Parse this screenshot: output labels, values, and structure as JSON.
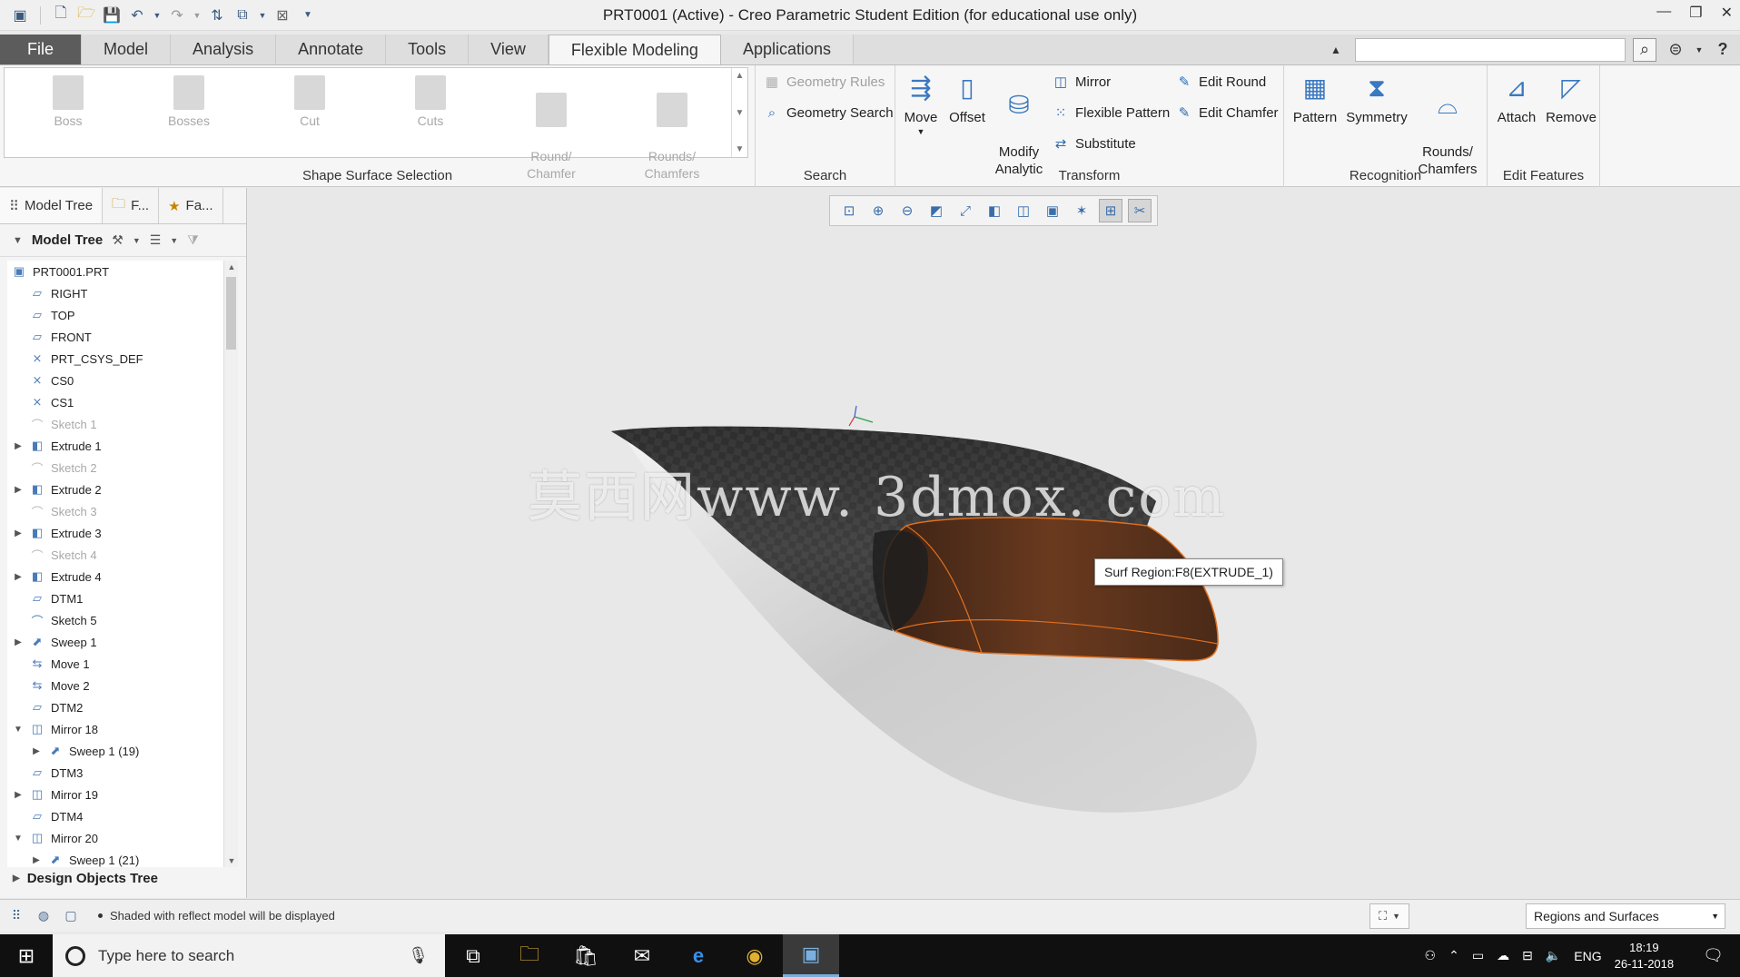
{
  "window": {
    "title": "PRT0001 (Active) - Creo Parametric Student Edition (for educational use only)",
    "controls": [
      "—",
      "❐",
      "✕"
    ]
  },
  "quick_access": [
    "new-icon",
    "open-icon",
    "save-icon",
    "undo-icon",
    "redo-icon",
    "regenerate-icon",
    "windows-icon",
    "close-window-icon"
  ],
  "ribbon_tabs": [
    {
      "label": "File"
    },
    {
      "label": "Model"
    },
    {
      "label": "Analysis"
    },
    {
      "label": "Annotate"
    },
    {
      "label": "Tools"
    },
    {
      "label": "View"
    },
    {
      "label": "Flexible Modeling"
    },
    {
      "label": "Applications"
    }
  ],
  "ribbon": {
    "shape_surface": {
      "label": "Shape Surface Selection",
      "items": [
        "Boss",
        "Bosses",
        "Cut",
        "Cuts",
        "Round/\nChamfer",
        "Rounds/\nChamfers"
      ]
    },
    "search": {
      "label": "Search",
      "geometry_rules": "Geometry Rules",
      "geometry_search": "Geometry Search"
    },
    "transform": {
      "label": "Transform",
      "move": "Move",
      "offset": "Offset",
      "modify_analytic": "Modify\nAnalytic",
      "mirror": "Mirror",
      "flexible_pattern": "Flexible Pattern",
      "substitute": "Substitute",
      "edit_round": "Edit Round",
      "edit_chamfer": "Edit Chamfer"
    },
    "recognition": {
      "label": "Recognition",
      "pattern": "Pattern",
      "symmetry": "Symmetry",
      "rounds_chamfers": "Rounds/\nChamfers"
    },
    "edit_features": {
      "label": "Edit Features",
      "attach": "Attach",
      "remove": "Remove"
    }
  },
  "navigator": {
    "tabs": [
      "Model Tree",
      "F...",
      "Fa..."
    ],
    "header": "Model Tree",
    "design_objects": "Design Objects Tree",
    "tree": [
      {
        "label": "PRT0001.PRT",
        "icon": "part-icon",
        "level": 0,
        "expander": "",
        "dim": false
      },
      {
        "label": "RIGHT",
        "icon": "datum-plane-icon",
        "level": 1,
        "expander": "",
        "dim": false
      },
      {
        "label": "TOP",
        "icon": "datum-plane-icon",
        "level": 1,
        "expander": "",
        "dim": false
      },
      {
        "label": "FRONT",
        "icon": "datum-plane-icon",
        "level": 1,
        "expander": "",
        "dim": false
      },
      {
        "label": "PRT_CSYS_DEF",
        "icon": "csys-icon",
        "level": 1,
        "expander": "",
        "dim": false
      },
      {
        "label": "CS0",
        "icon": "csys-icon",
        "level": 1,
        "expander": "",
        "dim": false
      },
      {
        "label": "CS1",
        "icon": "csys-icon",
        "level": 1,
        "expander": "",
        "dim": false
      },
      {
        "label": "Sketch 1",
        "icon": "sketch-icon",
        "level": 1,
        "expander": "",
        "dim": true
      },
      {
        "label": "Extrude 1",
        "icon": "extrude-icon",
        "level": 1,
        "expander": "▶",
        "dim": false
      },
      {
        "label": "Sketch 2",
        "icon": "sketch-icon",
        "level": 1,
        "expander": "",
        "dim": true
      },
      {
        "label": "Extrude 2",
        "icon": "extrude-icon",
        "level": 1,
        "expander": "▶",
        "dim": false
      },
      {
        "label": "Sketch 3",
        "icon": "sketch-icon",
        "level": 1,
        "expander": "",
        "dim": true
      },
      {
        "label": "Extrude 3",
        "icon": "extrude-icon",
        "level": 1,
        "expander": "▶",
        "dim": false
      },
      {
        "label": "Sketch 4",
        "icon": "sketch-icon",
        "level": 1,
        "expander": "",
        "dim": true
      },
      {
        "label": "Extrude 4",
        "icon": "extrude-icon",
        "level": 1,
        "expander": "▶",
        "dim": false
      },
      {
        "label": "DTM1",
        "icon": "datum-plane-icon",
        "level": 1,
        "expander": "",
        "dim": false
      },
      {
        "label": "Sketch 5",
        "icon": "sketch-icon",
        "level": 1,
        "expander": "",
        "dim": false
      },
      {
        "label": "Sweep 1",
        "icon": "sweep-icon",
        "level": 1,
        "expander": "▶",
        "dim": false
      },
      {
        "label": "Move 1",
        "icon": "move-icon",
        "level": 1,
        "expander": "",
        "dim": false
      },
      {
        "label": "Move 2",
        "icon": "move-icon",
        "level": 1,
        "expander": "",
        "dim": false
      },
      {
        "label": "DTM2",
        "icon": "datum-plane-icon",
        "level": 1,
        "expander": "",
        "dim": false
      },
      {
        "label": "Mirror 18",
        "icon": "mirror-icon",
        "level": 1,
        "expander": "▼",
        "dim": false
      },
      {
        "label": "Sweep 1 (19)",
        "icon": "sweep-icon",
        "level": 2,
        "expander": "▶",
        "dim": false
      },
      {
        "label": "DTM3",
        "icon": "datum-plane-icon",
        "level": 1,
        "expander": "",
        "dim": false
      },
      {
        "label": "Mirror 19",
        "icon": "mirror-icon",
        "level": 1,
        "expander": "▶",
        "dim": false
      },
      {
        "label": "DTM4",
        "icon": "datum-plane-icon",
        "level": 1,
        "expander": "",
        "dim": false
      },
      {
        "label": "Mirror 20",
        "icon": "mirror-icon",
        "level": 1,
        "expander": "▼",
        "dim": false
      },
      {
        "label": "Sweep 1 (21)",
        "icon": "sweep-icon",
        "level": 2,
        "expander": "▶",
        "dim": false
      }
    ]
  },
  "graphics": {
    "view_toolbar": [
      "refit-icon",
      "zoom-in-icon",
      "zoom-out-icon",
      "repaint-icon",
      "reorient-icon",
      "saved-views-icon",
      "display-style-icon",
      "perspective-icon",
      "datum-display-icon",
      "spin-center-icon",
      "annotation-display-icon"
    ],
    "tooltip": "Surf Region:F8(EXTRUDE_1)",
    "watermark": "莫西网www. 3dmox. com",
    "highlight_color": "#e07020"
  },
  "status": {
    "message": "Shaded with reflect model will be displayed",
    "selection_filter": "Regions and Surfaces"
  },
  "taskbar": {
    "search_placeholder": "Type here to search",
    "language": "ENG",
    "time": "18:19",
    "date": "26-11-2018"
  }
}
